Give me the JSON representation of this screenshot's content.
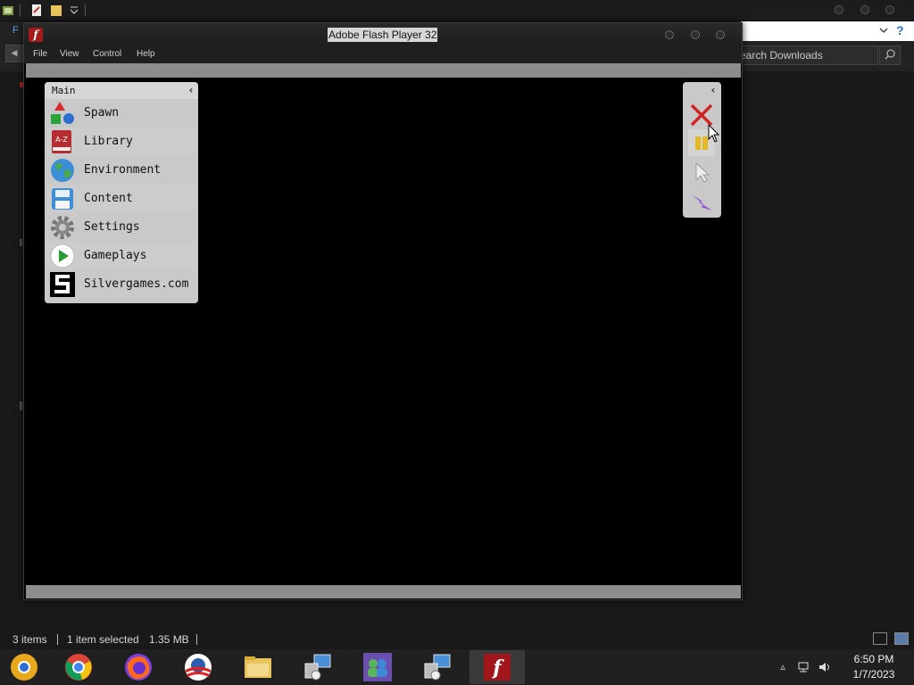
{
  "flash_window": {
    "title": "Adobe Flash Player 32",
    "menu": [
      "File",
      "View",
      "Control",
      "Help"
    ]
  },
  "main_panel": {
    "title": "Main",
    "items": [
      {
        "label": "Spawn",
        "icon": "shapes-icon"
      },
      {
        "label": "Library",
        "icon": "a-z-book-icon",
        "icon_text": "A-Z"
      },
      {
        "label": "Environment",
        "icon": "globe-icon"
      },
      {
        "label": "Content",
        "icon": "floppy-disk-icon"
      },
      {
        "label": "Settings",
        "icon": "gear-icon"
      },
      {
        "label": "Gameplays",
        "icon": "play-icon"
      },
      {
        "label": "Silvergames.com",
        "icon": "silvergames-logo-icon"
      }
    ]
  },
  "tool_panel": {
    "tools": [
      {
        "name": "delete",
        "icon": "red-x-icon"
      },
      {
        "name": "pause",
        "icon": "pause-icon"
      },
      {
        "name": "select",
        "icon": "pointer-icon"
      },
      {
        "name": "power",
        "icon": "lightning-icon"
      }
    ]
  },
  "explorer": {
    "search_placeholder": "Search Downloads",
    "tab_letter": "F",
    "status": {
      "items": "3 items",
      "selected": "1 item selected",
      "size": "1.35 MB"
    }
  },
  "taskbar": {
    "apps": [
      "chrome-canary",
      "chrome",
      "firefox",
      "obama-logo",
      "file-explorer",
      "network-app",
      "windows-live-messenger",
      "network-app-2",
      "flash-player"
    ],
    "active_app": "flash-player",
    "clock": {
      "time": "6:50 PM",
      "date": "1/7/2023"
    }
  },
  "colors": {
    "panel_bg": "#c9c9c9",
    "canvas_bg": "#000000",
    "flash_red": "#a31a1a"
  }
}
